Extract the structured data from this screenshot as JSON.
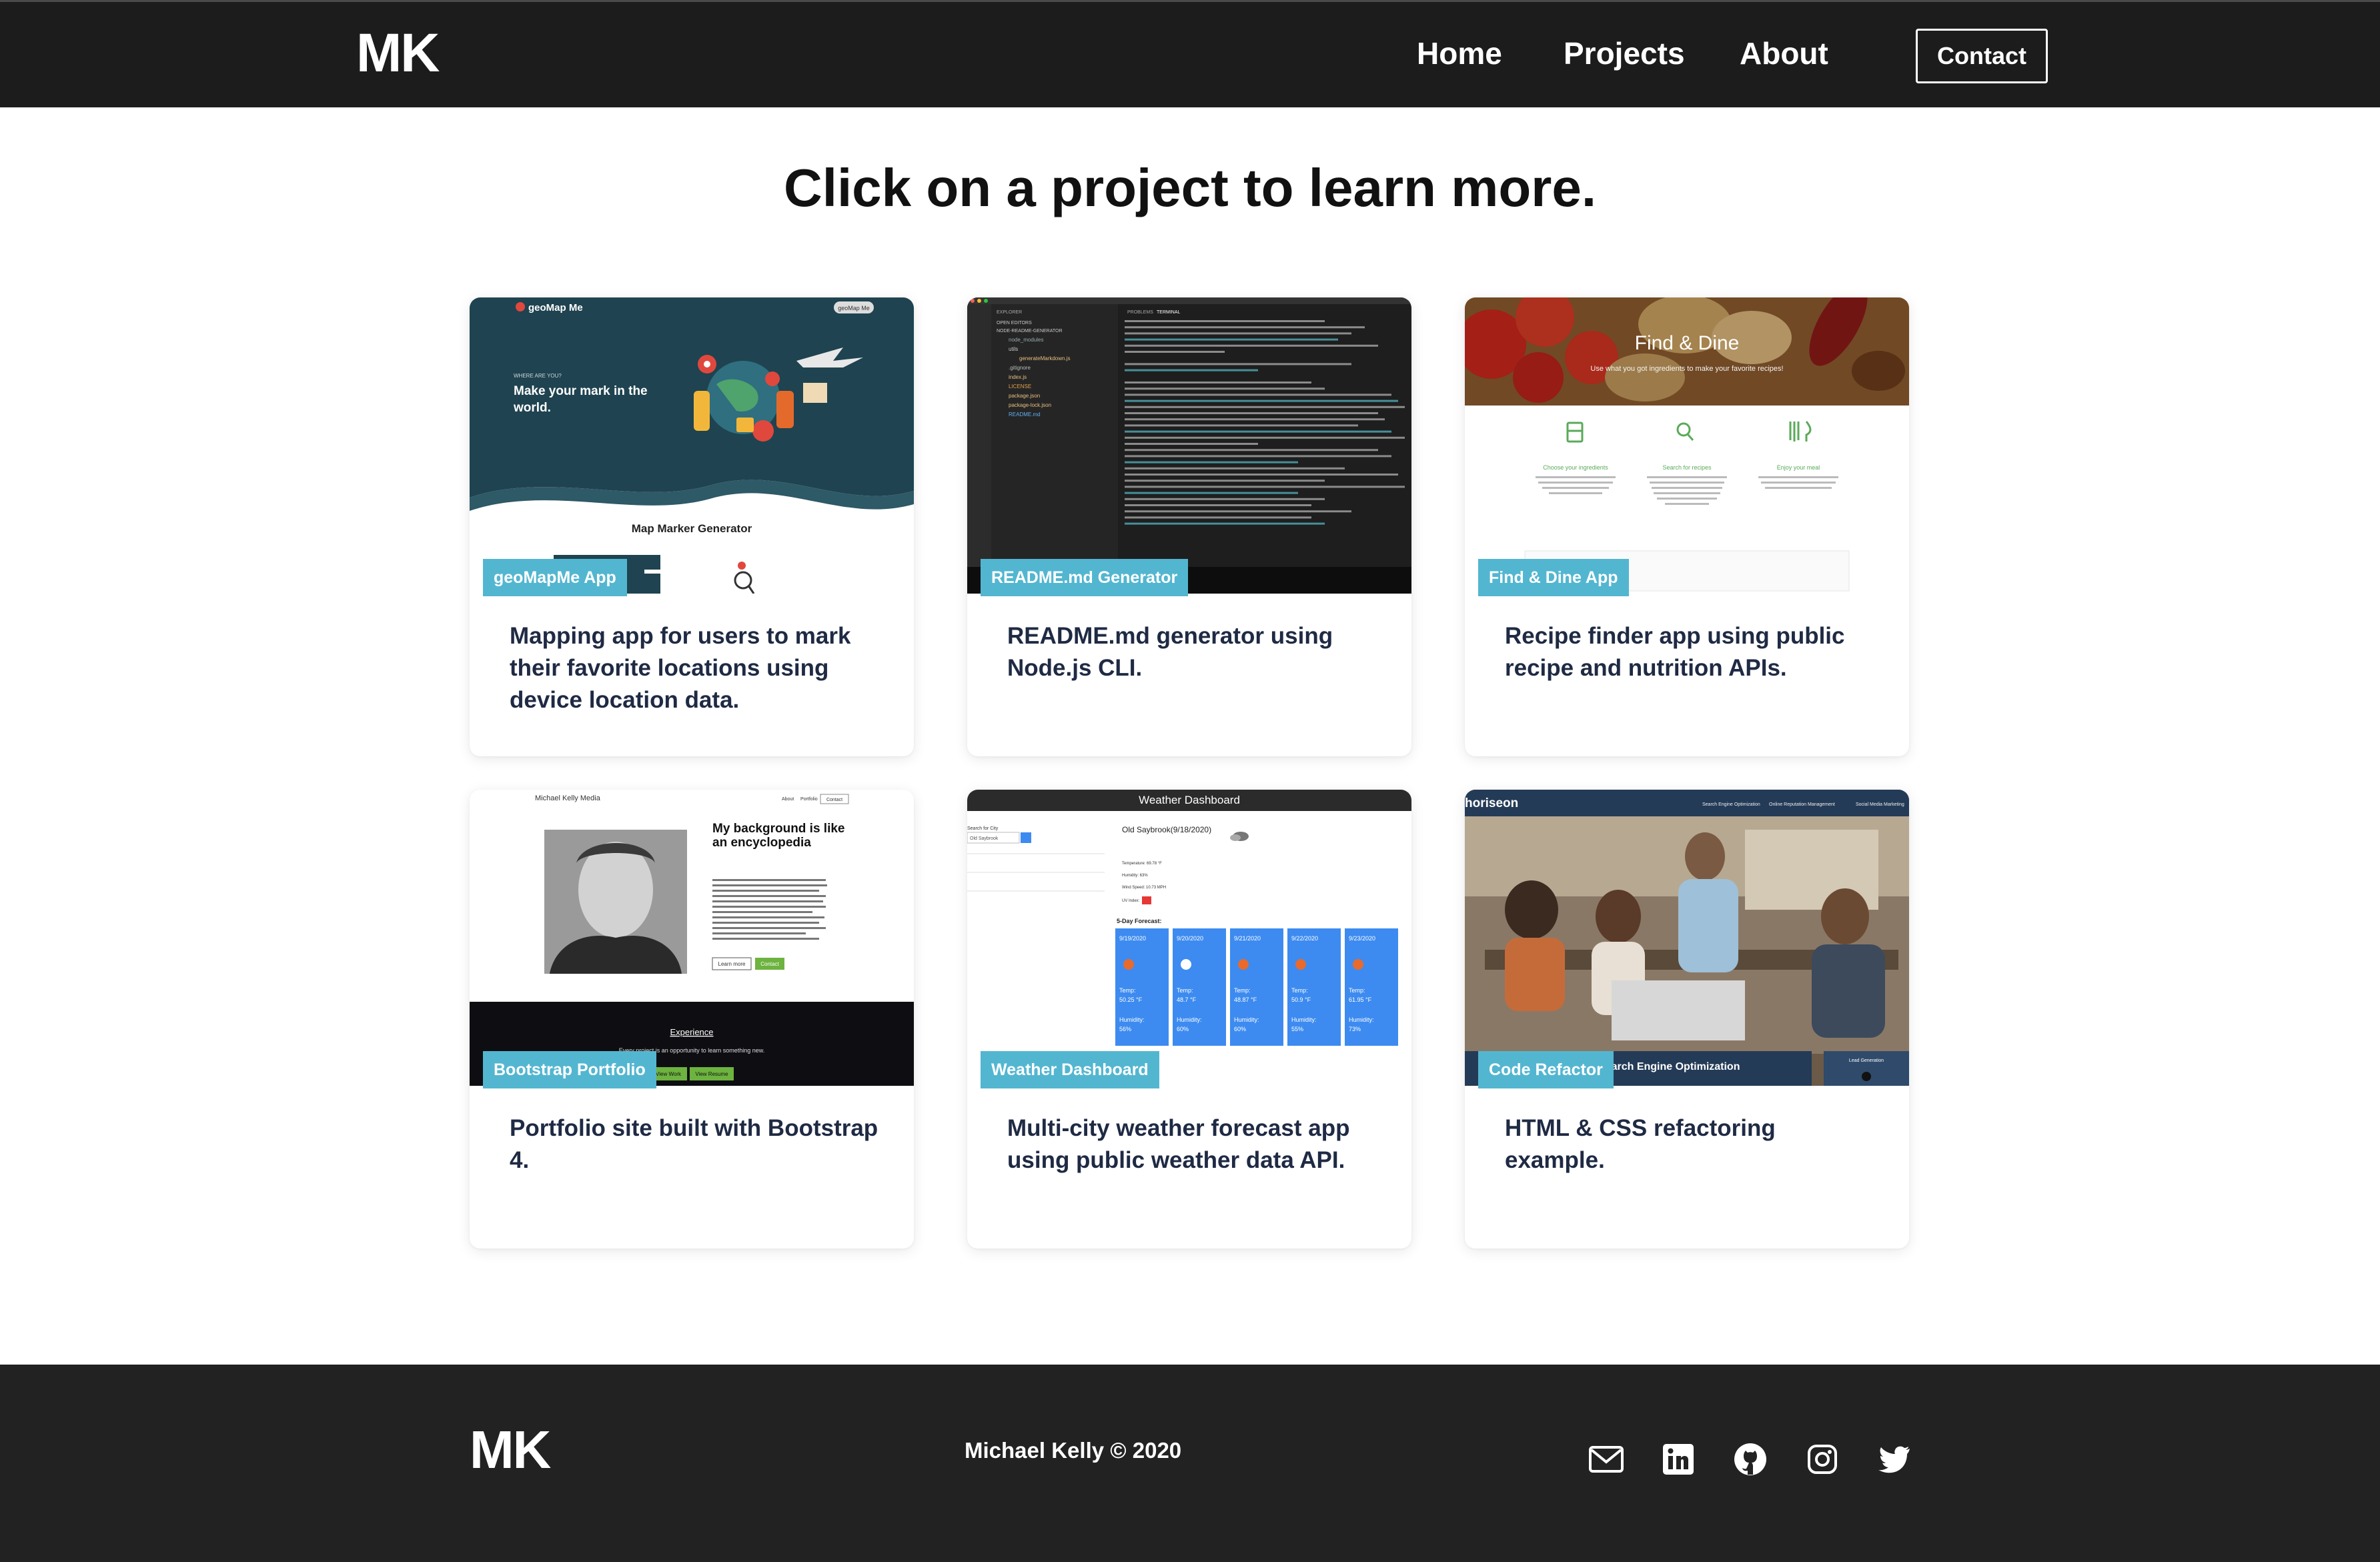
{
  "header": {
    "brand": "MK",
    "nav": [
      "Home",
      "Projects",
      "About"
    ],
    "contact_label": "Contact"
  },
  "main": {
    "heading": "Click on a project to learn more.",
    "projects": [
      {
        "badge": "geoMapMe App",
        "description": "Mapping app for users to mark their favorite locations using device location data.",
        "thumbnail": {
          "logo": "geoMap Me",
          "pill": "geoMap Me",
          "small_caps": "WHERE ARE YOU?",
          "tagline": "Make your mark in the world.",
          "section_title": "Map Marker Generator"
        }
      },
      {
        "badge": "README.md Generator",
        "description": "README.md generator using Node.js CLI.",
        "thumbnail": {
          "explorer": "EXPLORER",
          "open_editors": "OPEN EDITORS",
          "folder": "NODE-README-GENERATOR",
          "terminal_tab": "TERMINAL",
          "problems_tab": "PROBLEMS",
          "files": [
            "node_modules",
            "utils",
            "generateMarkdown.js",
            ".gitignore",
            "index.js",
            "LICENSE",
            "package.json",
            "package-lock.json",
            "README.md"
          ]
        }
      },
      {
        "badge": "Find & Dine App",
        "description": "Recipe finder app using public recipe and nutrition APIs.",
        "thumbnail": {
          "title": "Find & Dine",
          "subtitle": "Use what you got ingredients to make your favorite recipes!",
          "steps": [
            "Choose your ingredients",
            "Search for recipes",
            "Enjoy your meal"
          ]
        }
      },
      {
        "badge": "Bootstrap Portfolio",
        "description": "Portfolio site built with Bootstrap 4.",
        "thumbnail": {
          "site_name": "Michael Kelly Media",
          "nav": [
            "About",
            "Portfolio",
            "Contact"
          ],
          "headline": "My background is like an encyclopedia",
          "learn_more": "Learn more",
          "contact": "Contact",
          "experience": "Experience",
          "experience_sub": "Every project is an opportunity to learn something new.",
          "view_work": "View Work",
          "view_resume": "View Resume"
        }
      },
      {
        "badge": "Weather Dashboard",
        "description": "Multi-city weather forecast app using public weather data API.",
        "thumbnail": {
          "title": "Weather Dashboard",
          "search_label": "Search for City",
          "search_value": "Old Saybrook",
          "city_heading": "Old Saybrook(9/18/2020)",
          "temperature": "Temperature: 69.78 °F",
          "humidity": "Humidity: 63%",
          "wind": "Wind Speed: 10.73 MPH",
          "uv": "UV Index:",
          "forecast_label": "5-Day Forecast:",
          "forecast": [
            {
              "date": "9/19/2020",
              "temp": "Temp: 50.25 °F",
              "humidity": "Humidity: 56%"
            },
            {
              "date": "9/20/2020",
              "temp": "Temp: 48.7 °F",
              "humidity": "Humidity: 60%"
            },
            {
              "date": "9/21/2020",
              "temp": "Temp: 48.87 °F",
              "humidity": "Humidity: 60%"
            },
            {
              "date": "9/22/2020",
              "temp": "Temp: 50.9 °F",
              "humidity": "Humidity: 55%"
            },
            {
              "date": "9/23/2020",
              "temp": "Temp: 61.95 °F",
              "humidity": "Humidity: 73%"
            }
          ]
        }
      },
      {
        "badge": "Code Refactor",
        "description": "HTML & CSS refactoring example.",
        "thumbnail": {
          "logo": "horiseon",
          "nav": [
            "Search Engine Optimization",
            "Online Reputation Management",
            "Social Media Marketing"
          ],
          "panel_title": "Search Engine Optimization",
          "panel_side": "Lead Generation"
        }
      }
    ]
  },
  "footer": {
    "brand": "MK",
    "copyright": "Michael Kelly © 2020",
    "social": [
      "mail-icon",
      "linkedin-icon",
      "github-icon",
      "instagram-icon",
      "twitter-icon"
    ]
  },
  "colors": {
    "nav_bg": "#1c1c1c",
    "footer_bg": "#222222",
    "badge": "#53b6d0",
    "description_text": "#1f2a44",
    "weather_card": "#3d8bf0"
  }
}
